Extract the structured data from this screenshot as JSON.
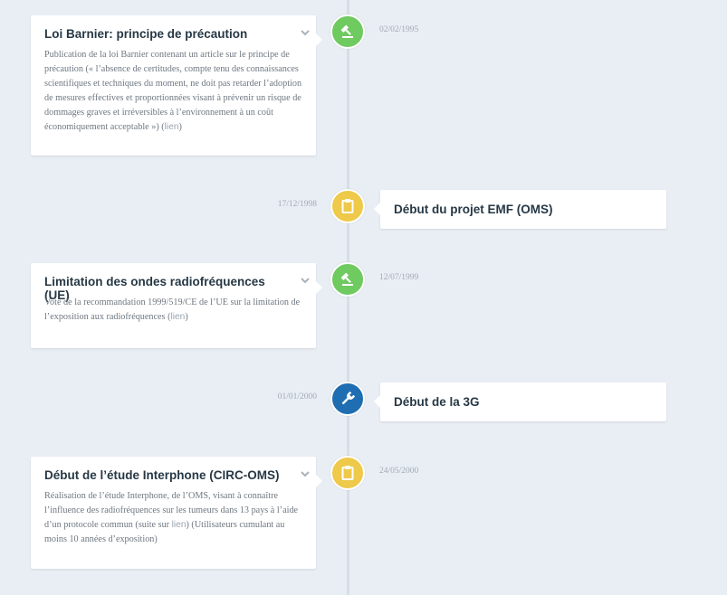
{
  "colors": {
    "green": "#6fca60",
    "yellow": "#eec94a",
    "blue": "#1f6eb1",
    "background": "#e9eef5"
  },
  "events": [
    {
      "title": "Loi Barnier: principe de précaution",
      "date": "02/02/1995",
      "icon": "gavel-icon",
      "text_before": "Publication de la loi Barnier contenant un article sur le principe de précaution (« l’absence de certitudes, compte tenu des connaissances scientifiques et techniques du moment, ne doit pas retarder l’adoption de mesures effectives et proportionnées visant à prévenir un risque de dommages graves et irréversibles à l’environnement à un coût économiquement acceptable ») (",
      "link": "lien",
      "text_after": ")"
    },
    {
      "title": "Début du projet EMF (OMS)",
      "date": "17/12/1998",
      "icon": "clipboard-icon"
    },
    {
      "title": "Limitation des ondes radiofréquences (UE)",
      "date": "12/07/1999",
      "icon": "gavel-icon",
      "text_before": "Vote de la recommandation 1999/519/CE de l’UE sur la limitation de l’exposition aux radiofréquences (",
      "link": "lien",
      "text_after": ")"
    },
    {
      "title": "Début de la 3G",
      "date": "01/01/2000",
      "icon": "wrench-icon"
    },
    {
      "title": "Début de l’étude Interphone (CIRC-OMS)",
      "date": "24/05/2000",
      "icon": "clipboard-icon",
      "text_before": "Réalisation de l’étude Interphone, de l’OMS, visant à connaître l’influence des radiofréquences sur les tumeurs dans 13 pays à l’aide d’un protocole commun (suite sur ",
      "link": "lien",
      "text_after": ") (Utilisateurs cumulant au moins 10 années d’exposition)"
    }
  ]
}
